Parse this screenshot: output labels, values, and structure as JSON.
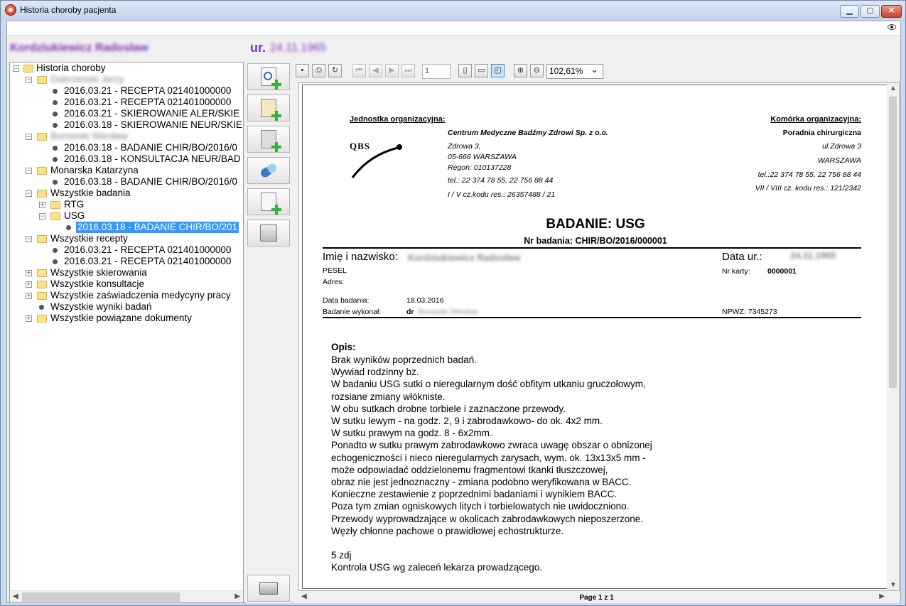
{
  "window": {
    "title": "Historia choroby pacjenta",
    "minimize": "▁",
    "maximize": "▢",
    "close": "✕"
  },
  "patient": {
    "name": "Kordziukiewicz Radosław",
    "birth_label": "ur.",
    "birth_date": "24.11.1965"
  },
  "tree": {
    "root": "Historia choroby",
    "doctor1": "Dobrzenski Jerzy",
    "doctor1_items": [
      "2016.03.21 - RECEPTA 021401000000",
      "2016.03.21 - RECEPTA 021401000000",
      "2016.03.21 - SKIEROWANIE ALER/SKIE",
      "2016.03.18 - SKIEROWANIE NEUR/SKIE"
    ],
    "doctor2": "Borowski Wiesław",
    "doctor2_items": [
      "2016.03.18 - BADANIE CHIR/BO/2016/0",
      "2016.03.18 - KONSULTACJA NEUR/BAD"
    ],
    "doctor3": "Monarska Katarzyna",
    "doctor3_items": [
      "2016.03.18 - BADANIE CHIR/BO/2016/0"
    ],
    "all_exams": "Wszystkie badania",
    "rtg": "RTG",
    "usg": "USG",
    "usg_item": "2016.03.18 - BADANIE CHIR/BO/201",
    "all_prescriptions": "Wszystkie recepty",
    "prescription_items": [
      "2016.03.21 - RECEPTA 021401000000",
      "2016.03.21 - RECEPTA 021401000000"
    ],
    "all_referrals": "Wszystkie skierowania",
    "all_consultations": "Wszystkie konsultacje",
    "all_certificates": "Wszystkie zaświadczenia medycyny pracy",
    "all_results": "Wszystkie wyniki badań",
    "all_related": "Wszystkie powiązane dokumenty"
  },
  "viewer": {
    "page_input": "1",
    "zoom": "102,61%",
    "footer": "Page 1 z 1"
  },
  "doc": {
    "org_label": "Jednostka organizacyjna:",
    "org_name": "Centrum Medyczne Badźmy Zdrowi Sp. z o.o.",
    "org_street": "Zdrowa 3,",
    "org_city": "05-666 WARSZAWA",
    "org_regon": "Regon: 010137228",
    "org_tel": "tel.: 22 374 78 55, 22 756 88 44",
    "org_code": "I / V cz.kodu res.: 26357488 / 21",
    "logo": "QBS",
    "cell_label": "Komórka organizacyjna:",
    "cell_name": "Poradnia chirurgiczna",
    "cell_street": "ul.Zdrowa 3",
    "cell_city": "WARSZAWA",
    "cell_tel": "tel.:22 374 78 55, 22 756 88 44",
    "cell_code": "VII / VIII cz. kodu res.: 121/2342",
    "title": "BADANIE: USG",
    "number": "Nr badania: CHIR/BO/2016/000001",
    "name_label": "Imię i nazwisko:",
    "name_value": "Kordziukiewicz Radosław",
    "dob_label": "Data ur.:",
    "dob_value": "24.11.1965",
    "pesel_label": "PESEL",
    "card_label": "Nr karty:",
    "card_value": "0000001",
    "address_label": "Adres:",
    "exam_date_label": "Data badania:",
    "exam_date_value": "18.03.2016",
    "performed_label": "Badanie wykonał:",
    "performed_prefix": "dr",
    "performed_name": "Borowski Wiesław",
    "npwz": "NPWZ: 7345273",
    "desc_label": "Opis:",
    "desc_lines": [
      "Brak wyników poprzednich badań.",
      "Wywiad rodzinny bz.",
      "W badaniu USG sutki o nieregularnym dość obfitym  utkaniu gruczołowym,",
      "rozsiane zmiany włókniste.",
      "W obu sutkach drobne torbiele i zaznaczone przewody.",
      "W sutku lewym - na godz. 2, 9 i zabrodawkowo- do ok. 4x2 mm.",
      "W sutku prawym na godz.  8 - 6x2mm.",
      "Ponadto w sutku prawym zabrodawkowo zwraca uwagę obszar o obnizonej",
      "echogeniczności i nieco nieregularnych zarysach, wym. ok. 13x13x5 mm -",
      "może odpowiadać oddzielonemu fragmentowi tkanki tłuszczowej,",
      "obraz nie jest jednoznaczny - zmiana podobno weryfikowana w BACC.",
      "Konieczne zestawienie z poprzednimi badaniami i wynikiem BACC.",
      "Poza tym zmian ogniskowych litych i torbielowatych nie uwidoczniono.",
      "Przewody wyprowadzające w okolicach zabrodawkowych nieposzerzone.",
      "Węzły chłonne pachowe o prawidłowej echostrukturze."
    ],
    "photos": "5 zdj",
    "recommendation": "Kontrola USG wg zaleceń lekarza prowadzącego."
  }
}
